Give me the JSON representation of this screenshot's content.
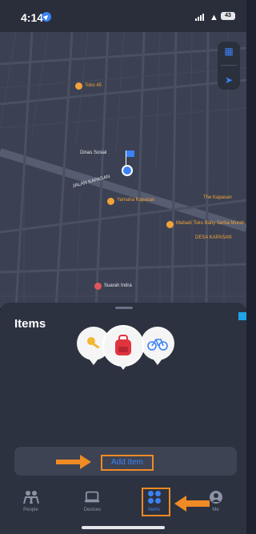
{
  "status_bar": {
    "time": "4:14",
    "battery": "43"
  },
  "map": {
    "labels": [
      {
        "text": "Toko 45",
        "color": "orange"
      },
      {
        "text": "Dinas Sosial",
        "color": "white"
      },
      {
        "text": "JALAN KAPASAN",
        "color": "white"
      },
      {
        "text": "Yamaha Kapasan",
        "color": "orange"
      },
      {
        "text": "Mabadi Toko Baby Serba Murah",
        "color": "orange"
      },
      {
        "text": "DESA KAPASAN",
        "color": "orange"
      },
      {
        "text": "Suarah Indra",
        "color": "white"
      },
      {
        "text": "The Kapasan",
        "color": "orange"
      }
    ]
  },
  "sheet": {
    "title": "Items",
    "add_item_label": "Add Item",
    "items": [
      {
        "icon": "key-icon"
      },
      {
        "icon": "backpack-icon"
      },
      {
        "icon": "bicycle-icon"
      }
    ]
  },
  "tabs": [
    {
      "label": "People",
      "icon": "people-icon",
      "active": false
    },
    {
      "label": "Devices",
      "icon": "devices-icon",
      "active": false
    },
    {
      "label": "Items",
      "icon": "items-grid-icon",
      "active": true
    },
    {
      "label": "Me",
      "icon": "person-icon",
      "active": false
    }
  ],
  "colors": {
    "accent": "#3b82f6",
    "highlight": "#f08a24",
    "map_bg": "#3b4152",
    "sheet_bg": "#2d3240"
  }
}
